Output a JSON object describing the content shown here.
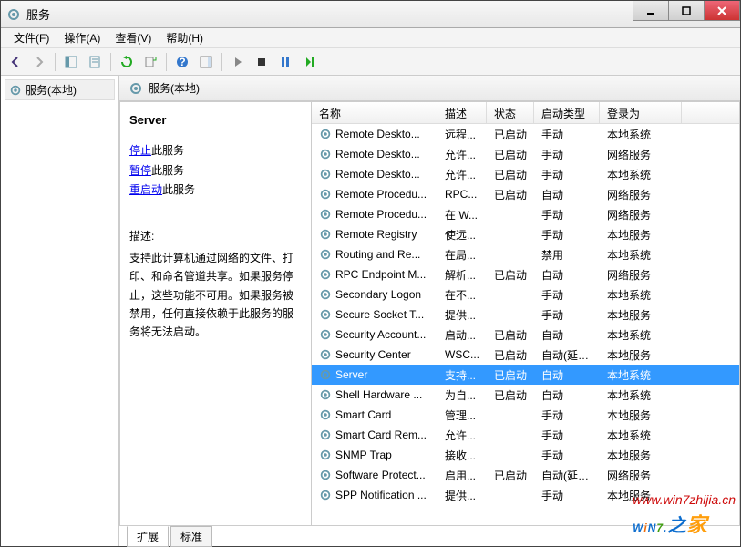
{
  "window": {
    "title": "服务"
  },
  "menu": {
    "file": "文件(F)",
    "action": "操作(A)",
    "view": "查看(V)",
    "help": "帮助(H)"
  },
  "tree": {
    "root": "服务(本地)"
  },
  "pane_header": "服务(本地)",
  "detail": {
    "title": "Server",
    "stop_link": "停止",
    "stop_suffix": "此服务",
    "pause_link": "暂停",
    "pause_suffix": "此服务",
    "restart_link": "重启动",
    "restart_suffix": "此服务",
    "desc_label": "描述:",
    "desc_text": "支持此计算机通过网络的文件、打印、和命名管道共享。如果服务停止，这些功能不可用。如果服务被禁用，任何直接依赖于此服务的服务将无法启动。"
  },
  "columns": {
    "name": "名称",
    "desc": "描述",
    "status": "状态",
    "startup": "启动类型",
    "logon": "登录为"
  },
  "services": [
    {
      "name": "Remote Deskto...",
      "desc": "远程...",
      "status": "已启动",
      "startup": "手动",
      "logon": "本地系统"
    },
    {
      "name": "Remote Deskto...",
      "desc": "允许...",
      "status": "已启动",
      "startup": "手动",
      "logon": "网络服务"
    },
    {
      "name": "Remote Deskto...",
      "desc": "允许...",
      "status": "已启动",
      "startup": "手动",
      "logon": "本地系统"
    },
    {
      "name": "Remote Procedu...",
      "desc": "RPC...",
      "status": "已启动",
      "startup": "自动",
      "logon": "网络服务"
    },
    {
      "name": "Remote Procedu...",
      "desc": "在 W...",
      "status": "",
      "startup": "手动",
      "logon": "网络服务"
    },
    {
      "name": "Remote Registry",
      "desc": "使远...",
      "status": "",
      "startup": "手动",
      "logon": "本地服务"
    },
    {
      "name": "Routing and Re...",
      "desc": "在局...",
      "status": "",
      "startup": "禁用",
      "logon": "本地系统"
    },
    {
      "name": "RPC Endpoint M...",
      "desc": "解析...",
      "status": "已启动",
      "startup": "自动",
      "logon": "网络服务"
    },
    {
      "name": "Secondary Logon",
      "desc": "在不...",
      "status": "",
      "startup": "手动",
      "logon": "本地系统"
    },
    {
      "name": "Secure Socket T...",
      "desc": "提供...",
      "status": "",
      "startup": "手动",
      "logon": "本地服务"
    },
    {
      "name": "Security Account...",
      "desc": "启动...",
      "status": "已启动",
      "startup": "自动",
      "logon": "本地系统"
    },
    {
      "name": "Security Center",
      "desc": "WSC...",
      "status": "已启动",
      "startup": "自动(延迟...",
      "logon": "本地服务"
    },
    {
      "name": "Server",
      "desc": "支持...",
      "status": "已启动",
      "startup": "自动",
      "logon": "本地系统",
      "selected": true
    },
    {
      "name": "Shell Hardware ...",
      "desc": "为自...",
      "status": "已启动",
      "startup": "自动",
      "logon": "本地系统"
    },
    {
      "name": "Smart Card",
      "desc": "管理...",
      "status": "",
      "startup": "手动",
      "logon": "本地服务"
    },
    {
      "name": "Smart Card Rem...",
      "desc": "允许...",
      "status": "",
      "startup": "手动",
      "logon": "本地系统"
    },
    {
      "name": "SNMP Trap",
      "desc": "接收...",
      "status": "",
      "startup": "手动",
      "logon": "本地服务"
    },
    {
      "name": "Software Protect...",
      "desc": "启用...",
      "status": "已启动",
      "startup": "自动(延迟...",
      "logon": "网络服务"
    },
    {
      "name": "SPP Notification ...",
      "desc": "提供...",
      "status": "",
      "startup": "手动",
      "logon": "本地服务"
    }
  ],
  "tabs": {
    "extended": "扩展",
    "standard": "标准"
  },
  "watermark": {
    "url": "www.win7zhijia.cn",
    "w": "W",
    "i": "i",
    "n": "N",
    "seven": "7",
    "dot": ".",
    "suffix": "之",
    "jia": "家"
  }
}
